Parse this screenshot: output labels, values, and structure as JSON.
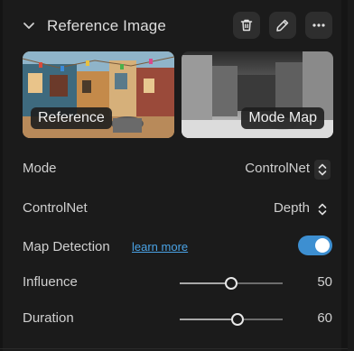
{
  "section": {
    "title": "Reference Image",
    "icons": [
      "chevron-down-icon",
      "trash-icon",
      "pencil-icon",
      "more-horizontal-icon"
    ]
  },
  "images": {
    "reference": {
      "label": "Reference"
    },
    "mode_map": {
      "label": "Mode Map"
    }
  },
  "settings": {
    "mode": {
      "label": "Mode",
      "value": "ControlNet"
    },
    "controlnet": {
      "label": "ControlNet",
      "value": "Depth"
    },
    "map_detection": {
      "label": "Map Detection",
      "link": "learn more",
      "enabled": true
    },
    "influence": {
      "label": "Influence",
      "value": "50",
      "level": 0.5
    },
    "duration": {
      "label": "Duration",
      "value": "60",
      "level": 0.56
    }
  },
  "colors": {
    "accent": "#3d8fd1",
    "link": "#4aa3e6",
    "background": "#1b1b1b",
    "button": "#2e2e2e"
  }
}
